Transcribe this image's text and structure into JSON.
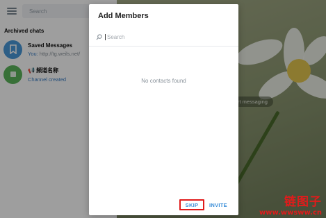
{
  "sidebar": {
    "search_placeholder": "Search",
    "section_title": "Archived chats",
    "chats": [
      {
        "name": "Saved Messages",
        "preview_prefix": "You:",
        "preview": " http://tg.weils.net/"
      },
      {
        "name": "📢 频道名称",
        "preview": "Channel created"
      }
    ]
  },
  "background": {
    "start_messaging": "rt messaging"
  },
  "modal": {
    "title": "Add Members",
    "search_placeholder": "Search",
    "empty_text": "No contacts found",
    "skip_label": "SKIP",
    "invite_label": "INVITE"
  },
  "watermark": {
    "text": "链图子",
    "url": "www.wwsww.cn"
  },
  "colors": {
    "accent": "#3a8ed8",
    "highlight_box": "#e01b1b",
    "avatar_saved": "#4a98d8",
    "avatar_channel": "#5bb55b"
  }
}
